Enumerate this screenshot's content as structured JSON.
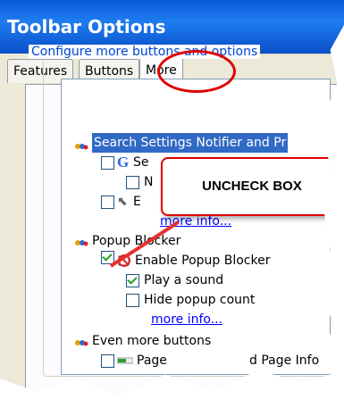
{
  "window": {
    "title": "Toolbar Options"
  },
  "tabs": [
    {
      "label": "Features"
    },
    {
      "label": "Buttons"
    },
    {
      "label": "More"
    }
  ],
  "group": {
    "legend": "Configure more buttons and options"
  },
  "tree": {
    "cat_search": "Search Settings Notifier and Pr",
    "item_s1": "Se",
    "item_n": "N",
    "item_e": "E",
    "more_info_1": "more info...",
    "cat_popup": "Popup Blocker",
    "item_enable_popup": "Enable Popup Blocker",
    "item_play_sound": "Play a sound",
    "item_hide_popup": "Hide popup count",
    "more_info_2": "more info...",
    "cat_even_more": "Even more buttons",
    "item_page": "Page",
    "item_page_info": "d Page Info"
  },
  "annotation": {
    "callout": "UNCHECK BOX"
  },
  "colors": {
    "annotation_red": "#e00000",
    "title_blue": "#0a5ad8",
    "link_blue": "#0000ff"
  }
}
